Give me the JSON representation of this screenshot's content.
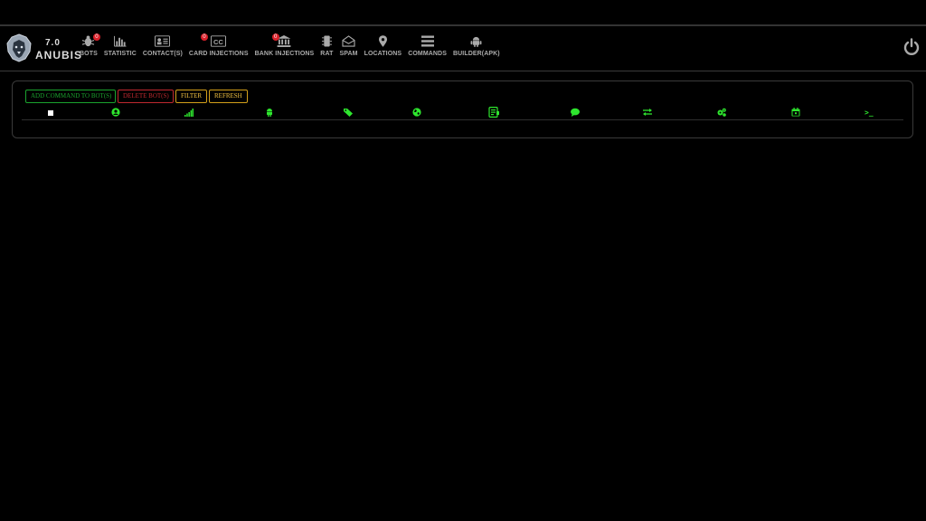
{
  "logo": {
    "version": "7.0",
    "name": "ANUBIS"
  },
  "nav": {
    "items": [
      {
        "key": "bots",
        "label": "BOTS",
        "icon": "bug-icon",
        "badge": "0"
      },
      {
        "key": "statistic",
        "label": "STATISTIC",
        "icon": "bar-chart-icon"
      },
      {
        "key": "contacts",
        "label": "CONTACT(S)",
        "icon": "contact-card-icon"
      },
      {
        "key": "card-injections",
        "label": "CARD INJECTIONS",
        "icon": "credit-card-icon",
        "badge": "0"
      },
      {
        "key": "bank-injections",
        "label": "BANK INJECTIONS",
        "icon": "bank-icon",
        "badge": "0"
      },
      {
        "key": "rat",
        "label": "RAT",
        "icon": "chip-icon"
      },
      {
        "key": "spam",
        "label": "SPAM",
        "icon": "envelope-icon"
      },
      {
        "key": "locations",
        "label": "LOCATIONS",
        "icon": "map-pin-icon"
      },
      {
        "key": "commands",
        "label": "COMMANDS",
        "icon": "menu-lines-icon"
      },
      {
        "key": "builder",
        "label": "BUILDER(APK)",
        "icon": "android-icon"
      }
    ]
  },
  "toolbar": {
    "add_label": "ADD COMMAND TO BOT(S)",
    "delete_label": "DELETE BOT(S)",
    "filter_label": "FILTER",
    "refresh_label": "REFRESH"
  },
  "table": {
    "header_icons": [
      "select-all-checkbox",
      "user-circle-icon",
      "signal-bars-icon",
      "android-icon",
      "tag-icon",
      "globe-icon",
      "phone-screen-icon",
      "chat-bubble-icon",
      "exchange-arrows-icon",
      "gears-icon",
      "calendar-icon",
      "terminal-icon"
    ],
    "terminal_glyph": ">_"
  },
  "colors": {
    "accent_green": "#2ee62e",
    "danger_red": "#c0282f",
    "warning_yellow": "#d4a01a",
    "badge_red": "#d9202a"
  }
}
